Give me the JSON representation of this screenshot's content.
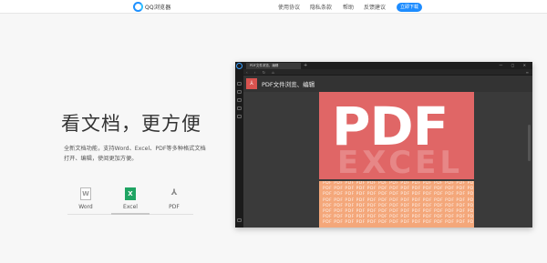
{
  "nav": {
    "logo_text": "QQ浏览器",
    "items": [
      "使用协议",
      "隐私条款",
      "帮助",
      "反馈建议"
    ],
    "download": "立即下载"
  },
  "hero": {
    "title": "看文档，更方便",
    "desc_line1": "全新文档功能，支持Word、Excel、PDF等多种格式文档",
    "desc_line2": "打开、编辑，使阅更加方便。"
  },
  "formats": [
    {
      "label": "Word",
      "icon": "W"
    },
    {
      "label": "Excel",
      "icon": "X"
    },
    {
      "label": "PDF",
      "icon": "⅄"
    }
  ],
  "app": {
    "tab_title": "PDF文件浏览、编辑",
    "doc_title": "PDF文件浏览、编辑",
    "page_big_text": "PDF",
    "ghost_text": "EXCEL",
    "tile_text": "PDF PDF PDF PDF PDF PDF PDF PDF PDF PDF PDF PDF PDF PDF PDF PDF PDF PDF PDF PDF"
  }
}
